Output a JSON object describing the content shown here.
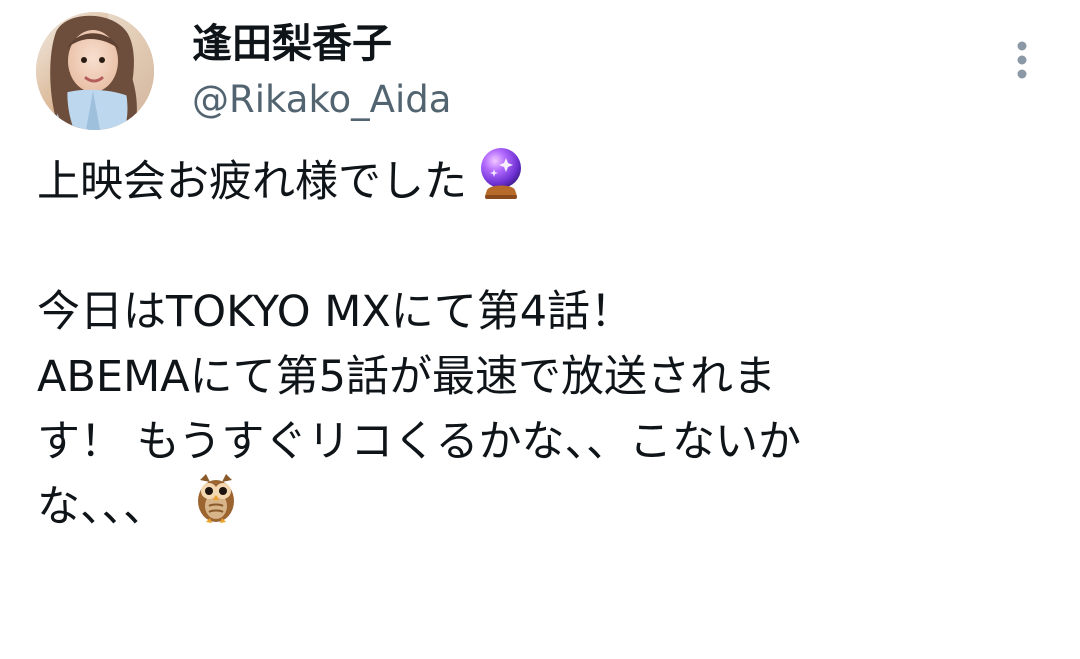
{
  "user": {
    "display_name": "逢田梨香子",
    "handle": "@Rikako_Aida"
  },
  "menu": {
    "icon": "more-vertical-icon"
  },
  "tweet": {
    "line1": "上映会お疲れ様でした",
    "line1_emoji": "crystal-ball-icon",
    "line2": "今日はTOKYO MXにて第4話！",
    "line3": "ABEMAにて第5話が最速で放送されま",
    "line4": "す！ もうすぐリコくるかな、、こないか",
    "line5": "な、、、",
    "line5_emoji": "owl-icon"
  },
  "colors": {
    "text": "#0f1419",
    "secondary": "#536471",
    "background": "#ffffff"
  }
}
